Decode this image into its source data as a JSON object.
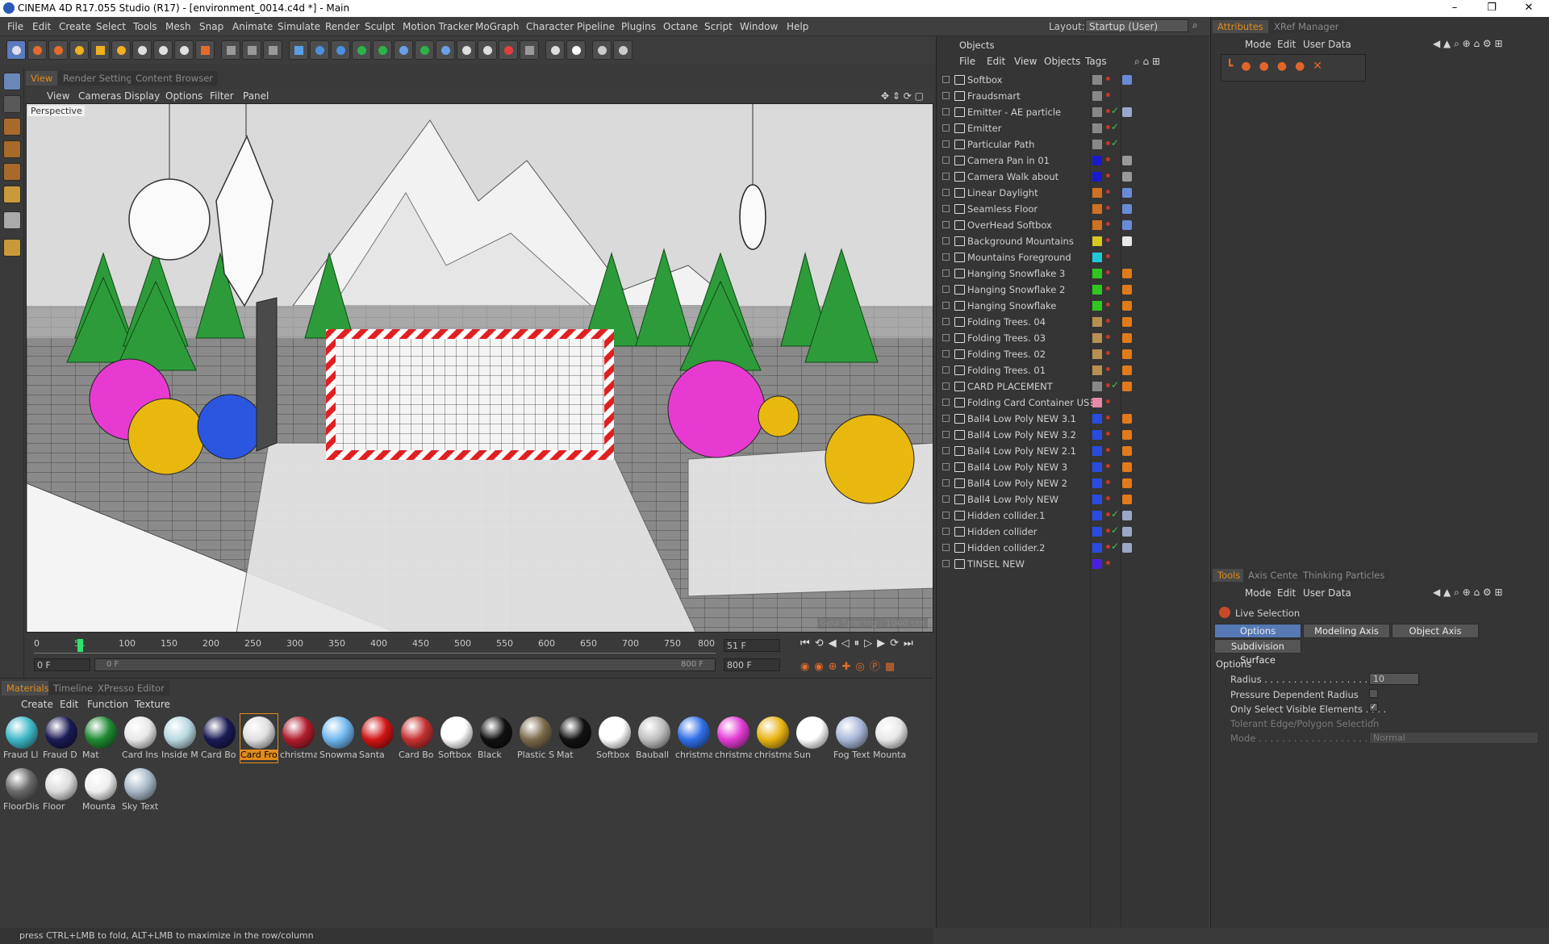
{
  "window": {
    "title": "CINEMA 4D R17.055 Studio (R17) - [environment_0014.c4d *] - Main",
    "controls": [
      "–",
      "❐",
      "✕"
    ]
  },
  "menubar": {
    "items": [
      "File",
      "Edit",
      "Create",
      "Select",
      "Tools",
      "Mesh",
      "Snap",
      "Animate",
      "Simulate",
      "Render",
      "Sculpt",
      "Motion Tracker",
      "MoGraph",
      "Character",
      "Pipeline",
      "Plugins",
      "Octane",
      "Script",
      "Window",
      "Help"
    ],
    "layout_label": "Layout:",
    "layout_value": "Startup (User)"
  },
  "viewport": {
    "tabs": [
      "View",
      "Render Settings",
      "Content Browser"
    ],
    "menu": [
      "View",
      "Cameras",
      "Display",
      "Options",
      "Filter",
      "Panel"
    ],
    "camera_label": "Perspective",
    "grid_spacing": "Grid Spacing : 1000 cm"
  },
  "timeline": {
    "ticks": [
      "0",
      "51",
      "100",
      "150",
      "200",
      "250",
      "300",
      "350",
      "400",
      "450",
      "500",
      "550",
      "600",
      "650",
      "700",
      "750",
      "800"
    ],
    "current_frame": "51 F",
    "start_field": "0 F",
    "range_start": "0 F",
    "range_end": "800 F",
    "end_field": "800 F",
    "position": 0.064
  },
  "materials": {
    "tabs": [
      "Materials",
      "Timeline",
      "XPresso Editor"
    ],
    "menu": [
      "Create",
      "Edit",
      "Function",
      "Texture"
    ],
    "row1": [
      {
        "name": "Fraud Ll",
        "color": "#3fb8c8"
      },
      {
        "name": "Fraud D",
        "color": "#1a1a55"
      },
      {
        "name": "Mat",
        "color": "#1f8a32"
      },
      {
        "name": "Card Ins",
        "color": "#e8e8e8"
      },
      {
        "name": "Inside M",
        "color": "#b8d8e0"
      },
      {
        "name": "Card Bo",
        "color": "#1a1a55"
      },
      {
        "name": "Card Fro",
        "color": "#e0e0e0",
        "selected": true
      },
      {
        "name": "christma",
        "color": "#b01c2c"
      },
      {
        "name": "Snowma",
        "color": "#6fb6ee"
      },
      {
        "name": "Santa",
        "color": "#d01414"
      },
      {
        "name": "Card Bo",
        "color": "#c43030"
      },
      {
        "name": "Softbox",
        "color": "#ffffff"
      },
      {
        "name": "Black",
        "color": "#111111"
      },
      {
        "name": "Plastic S",
        "color": "#7a6a4a"
      },
      {
        "name": "Mat",
        "color": "#111111"
      },
      {
        "name": "Softbox",
        "color": "#ffffff"
      },
      {
        "name": "Bauball",
        "color": "#bfbfbf"
      },
      {
        "name": "christma",
        "color": "#2f6ee6"
      },
      {
        "name": "christma",
        "color": "#e23bd4"
      },
      {
        "name": "christma",
        "color": "#e8b412"
      },
      {
        "name": "Sun",
        "color": "#ffffff"
      },
      {
        "name": "Fog Text",
        "color": "#a8b8d8"
      },
      {
        "name": "Mounta",
        "color": "#e8e8e8"
      }
    ],
    "row2": [
      {
        "name": "FloorDis",
        "color": "#6a6a6a"
      },
      {
        "name": "Floor",
        "color": "#dcdcdc"
      },
      {
        "name": "Mounta",
        "color": "#efefef"
      },
      {
        "name": "Sky Text",
        "color": "#a8b8c8"
      }
    ]
  },
  "status": "press CTRL+LMB to fold, ALT+LMB to maximize in the row/column",
  "objects": {
    "title": "Objects",
    "menu": [
      "File",
      "Edit",
      "View",
      "Objects",
      "Tags"
    ],
    "items": [
      {
        "name": "Softbox",
        "swatch": "#888888",
        "check": false,
        "tag": "#6a8ad8"
      },
      {
        "name": "Fraudsmart",
        "swatch": "#888888",
        "check": false,
        "tag": ""
      },
      {
        "name": "Emitter - AE particle",
        "swatch": "#888888",
        "check": true,
        "tag": "#9aa8c8"
      },
      {
        "name": "Emitter",
        "swatch": "#888888",
        "check": true,
        "tag": ""
      },
      {
        "name": "Particular Path",
        "swatch": "#888888",
        "check": true,
        "tag": ""
      },
      {
        "name": "Camera Pan in 01",
        "swatch": "#1a1acc",
        "check": false,
        "tag": "#9a9a9a"
      },
      {
        "name": "Camera  Walk about",
        "swatch": "#1a1acc",
        "check": false,
        "tag": "#9a9a9a"
      },
      {
        "name": "Linear Daylight",
        "swatch": "#d07020",
        "check": false,
        "tag": "#6a8ad8"
      },
      {
        "name": "Seamless Floor",
        "swatch": "#d07020",
        "check": false,
        "tag": "#6a8ad8"
      },
      {
        "name": "OverHead Softbox",
        "swatch": "#d07020",
        "check": false,
        "tag": "#6a8ad8"
      },
      {
        "name": "Background Mountains",
        "swatch": "#d8c820",
        "check": false,
        "tag": "#e8e8e8"
      },
      {
        "name": "Mountains Foreground",
        "swatch": "#20c8d8",
        "check": false,
        "tag": ""
      },
      {
        "name": "Hanging Snowflake 3",
        "swatch": "#30c820",
        "check": false,
        "tag": "#e07a1a"
      },
      {
        "name": "Hanging Snowflake 2",
        "swatch": "#30c820",
        "check": false,
        "tag": "#e07a1a"
      },
      {
        "name": "Hanging Snowflake",
        "swatch": "#30c820",
        "check": false,
        "tag": "#e07a1a"
      },
      {
        "name": "Folding Trees. 04",
        "swatch": "#b89050",
        "check": false,
        "tag": "#e07a1a"
      },
      {
        "name": "Folding Trees. 03",
        "swatch": "#b89050",
        "check": false,
        "tag": "#e07a1a"
      },
      {
        "name": "Folding Trees. 02",
        "swatch": "#b89050",
        "check": false,
        "tag": "#e07a1a"
      },
      {
        "name": "Folding Trees. 01",
        "swatch": "#b89050",
        "check": false,
        "tag": "#e07a1a"
      },
      {
        "name": "CARD PLACEMENT",
        "swatch": "#888888",
        "check": true,
        "tag": "#e07a1a"
      },
      {
        "name": "Folding Card Container USE",
        "swatch": "#e88aaa",
        "check": false,
        "tag": ""
      },
      {
        "name": "Ball4 Low Poly NEW 3.1",
        "swatch": "#2a4ae0",
        "check": false,
        "tag": "#e07a1a"
      },
      {
        "name": "Ball4 Low Poly NEW 3.2",
        "swatch": "#2a4ae0",
        "check": false,
        "tag": "#e07a1a"
      },
      {
        "name": "Ball4 Low Poly NEW 2.1",
        "swatch": "#2a4ae0",
        "check": false,
        "tag": "#e07a1a"
      },
      {
        "name": "Ball4 Low Poly NEW 3",
        "swatch": "#2a4ae0",
        "check": false,
        "tag": "#e07a1a"
      },
      {
        "name": "Ball4 Low Poly NEW 2",
        "swatch": "#2a4ae0",
        "check": false,
        "tag": "#e07a1a"
      },
      {
        "name": "Ball4 Low Poly NEW",
        "swatch": "#2a4ae0",
        "check": false,
        "tag": "#e07a1a"
      },
      {
        "name": "Hidden  collider.1",
        "swatch": "#2a4ae0",
        "check": true,
        "tag": "#9aa8c8"
      },
      {
        "name": "Hidden  collider",
        "swatch": "#2a4ae0",
        "check": true,
        "tag": "#9aa8c8"
      },
      {
        "name": "Hidden  collider.2",
        "swatch": "#2a4ae0",
        "check": true,
        "tag": "#9aa8c8"
      },
      {
        "name": "TINSEL NEW",
        "swatch": "#4a20e0",
        "check": false,
        "tag": ""
      }
    ]
  },
  "attributes": {
    "tabs": [
      "Attributes",
      "XRef Manager"
    ],
    "menu": [
      "Mode",
      "Edit",
      "User Data"
    ]
  },
  "tools": {
    "tabs": [
      "Tools",
      "Axis Center",
      "Thinking Particles"
    ],
    "menu": [
      "Mode",
      "Edit",
      "User Data"
    ],
    "tool_name": "Live Selection",
    "buttons": [
      "Options",
      "Modeling Axis",
      "Object Axis",
      "Subdivision Surface"
    ],
    "section": "Options",
    "radius_label": "Radius . . . . . . . . . . . . . . . . . . . .",
    "radius_value": "10",
    "pressure_label": "Pressure Dependent Radius",
    "visible_label": "Only Select Visible Elements . . . .",
    "tolerant_label": "Tolerant Edge/Polygon Selection",
    "mode_label": "Mode . . . . . . . . . . . . . . . . . . . . . . .",
    "mode_value": "Normal"
  }
}
